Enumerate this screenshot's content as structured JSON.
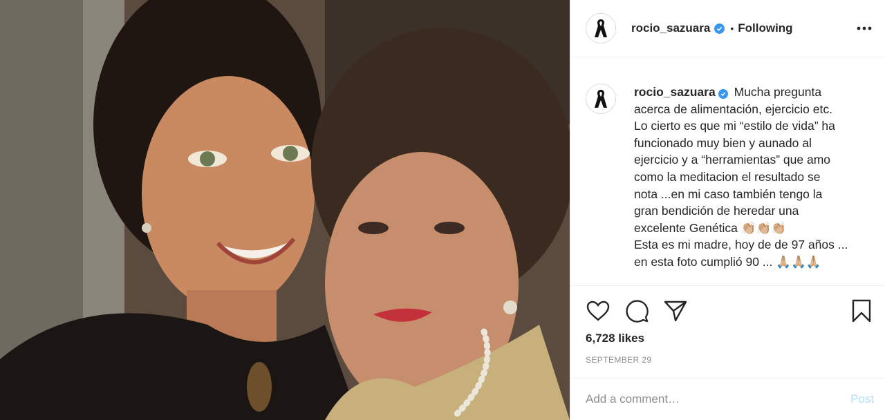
{
  "post": {
    "username": "rocio_sazuara",
    "dot": "•",
    "follow_status": "Following",
    "avatar_icon": "black-ribbon-icon",
    "caption_lines": [
      "Mucha pregunta",
      "acerca de alimentación, ejercicio etc.",
      "Lo cierto es que mi “estilo de vida” ha",
      "funcionado muy bien y aunado al",
      "ejercicio y a “herramientas” que amo",
      "como la meditacion el resultado se",
      "nota ...en mi caso también tengo la",
      "gran bendición de heredar una",
      "excelente Genética 👏🏼👏🏼👏🏼",
      "Esta es mi madre, hoy de de 97 años ...",
      "en esta foto cumplió 90 ... 🙏🏼🙏🏼🙏🏼"
    ],
    "likes": "6,728 likes",
    "date": "SEPTEMBER 29",
    "comment_placeholder": "Add a comment…",
    "post_label": "Post"
  },
  "colors": {
    "verified": "#3897f0",
    "post_disabled": "#b2dffc",
    "muted": "#8e8e8e"
  }
}
